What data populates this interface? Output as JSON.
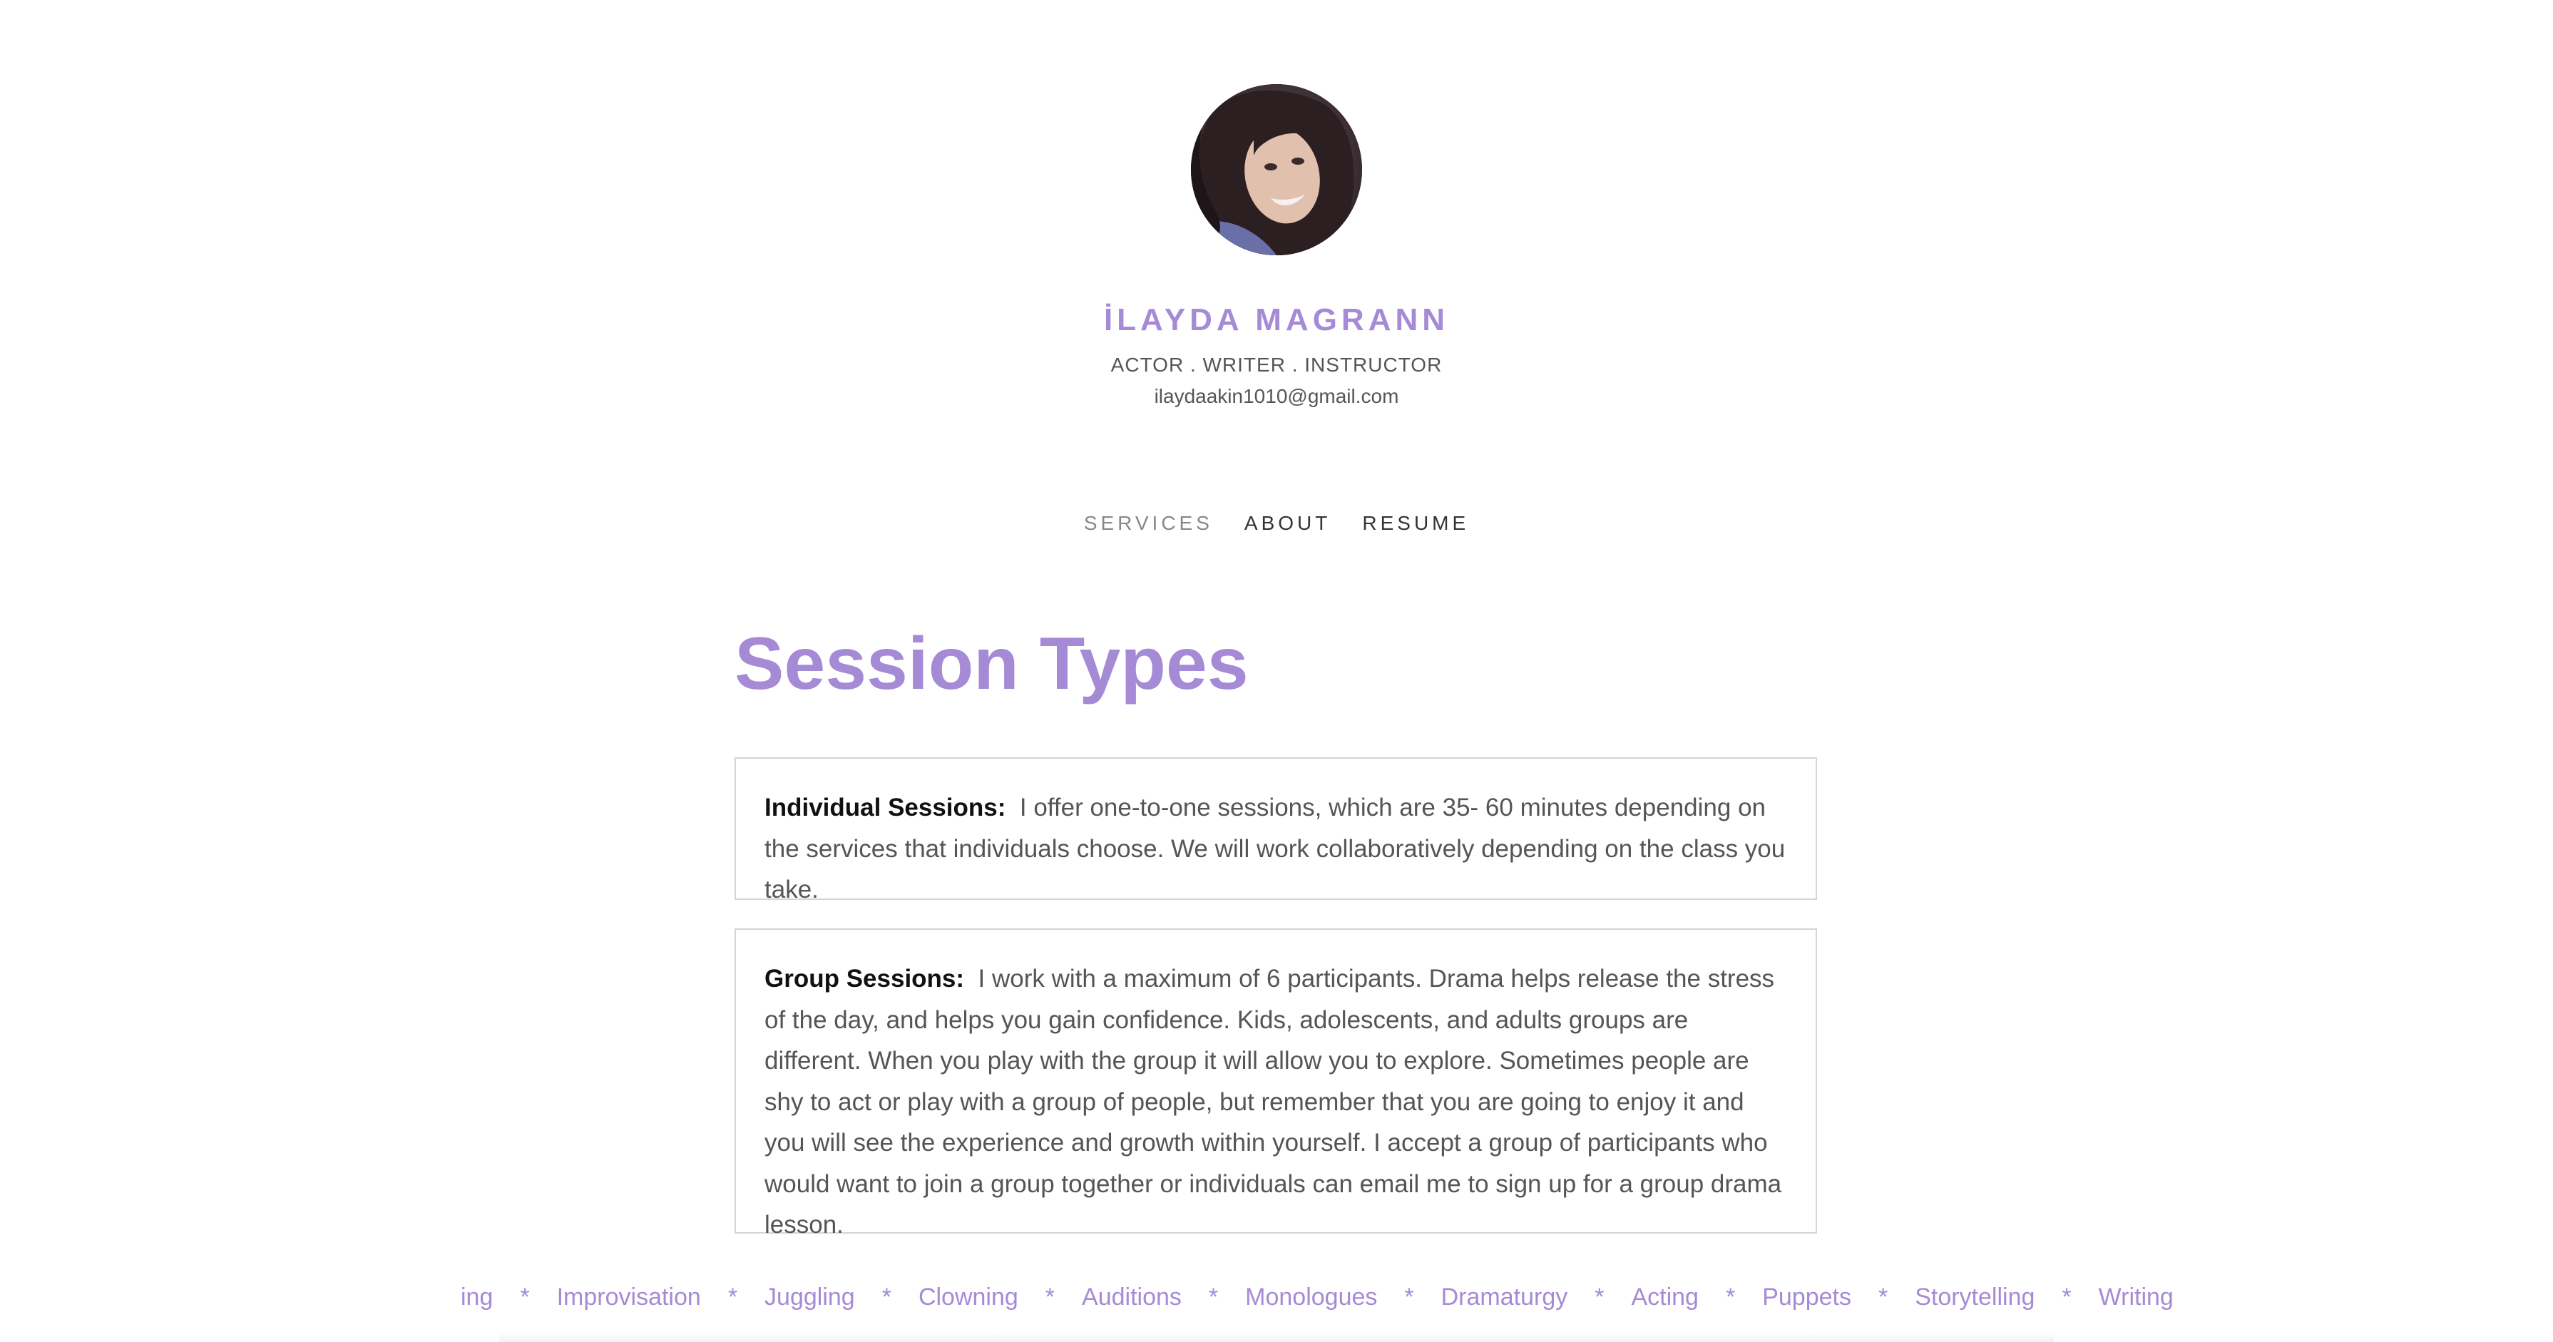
{
  "profile": {
    "avatar_alt": "profile photo",
    "name": "İLAYDA MAGRANN",
    "tagline": "ACTOR . WRITER . INSTRUCTOR",
    "email": "ilaydaakin1010@gmail.com"
  },
  "nav": {
    "items": [
      {
        "label": "SERVICES",
        "active": true
      },
      {
        "label": "ABOUT",
        "active": false
      },
      {
        "label": "RESUME",
        "active": false
      }
    ]
  },
  "main": {
    "title": "Session Types",
    "cards": [
      {
        "label": "Individual Sessions:",
        "text": "I offer one-to-one sessions, which are 35- 60 minutes depending on the services that individuals choose. We will work collaboratively depending on the class you take."
      },
      {
        "label": "Group Sessions:",
        "text": "I work with a maximum of 6 participants. Drama helps release the stress of the day, and helps you gain confidence. Kids, adolescents, and adults groups are different. When you play with the group it will allow you to explore. Sometimes people are shy to act or play with a group of people, but remember that you are going to enjoy it and you will see the experience and growth within yourself. I accept a group of participants who would want to join a group together or individuals can email me to sign up for a group drama lesson."
      }
    ]
  },
  "ticker": {
    "separator": "*",
    "words": [
      "ing",
      "Improvisation",
      "Juggling",
      "Clowning",
      "Auditions",
      "Monologues",
      "Dramaturgy",
      "Acting",
      "Puppets",
      "Storytelling",
      "Writing"
    ]
  },
  "colors": {
    "accent": "#a58ad6",
    "text": "#555555",
    "border": "#d4d4d4"
  }
}
